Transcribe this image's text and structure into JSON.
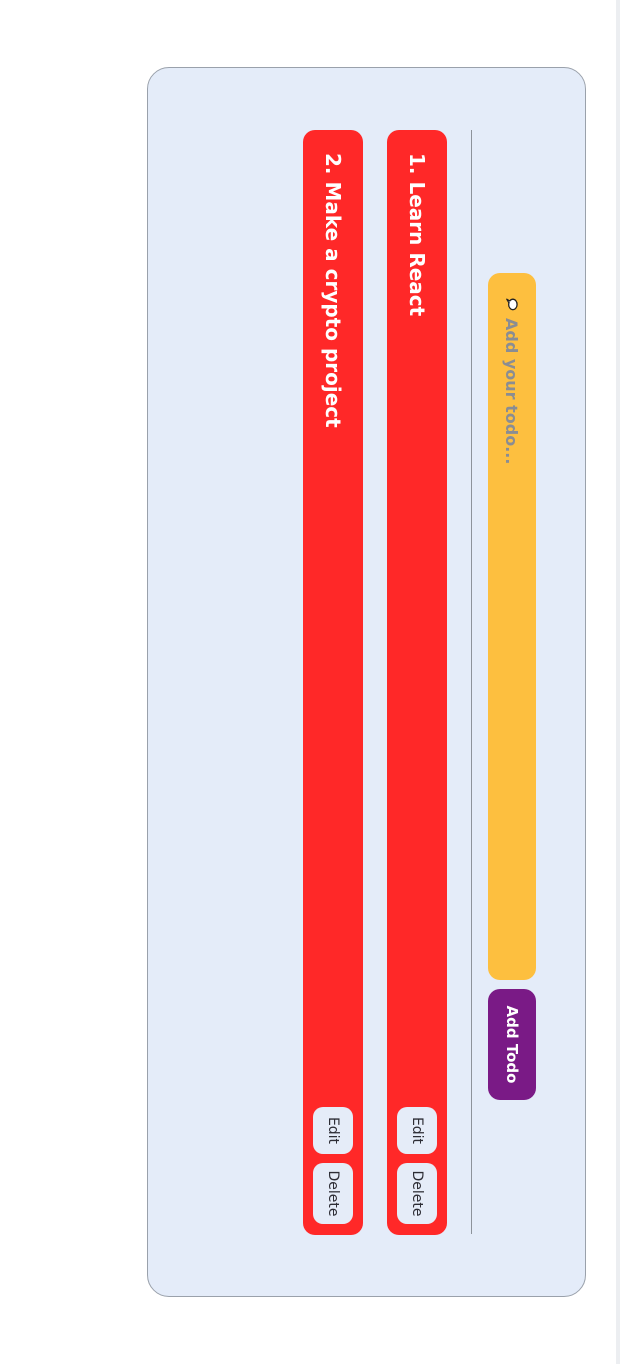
{
  "input": {
    "placeholder": "Add your todo...",
    "icon": "speech-bubble-icon"
  },
  "add_button": {
    "label": "Add Todo",
    "color": "#7a1a86"
  },
  "todos": [
    {
      "text": "1. Learn React",
      "edit_label": "Edit",
      "delete_label": "Delete"
    },
    {
      "text": "2. Make a crypto project",
      "edit_label": "Edit",
      "delete_label": "Delete"
    }
  ],
  "colors": {
    "card_bg": "#e4ecf9",
    "input_bg": "#fdbf3f",
    "todo_bg": "#ff2828"
  }
}
